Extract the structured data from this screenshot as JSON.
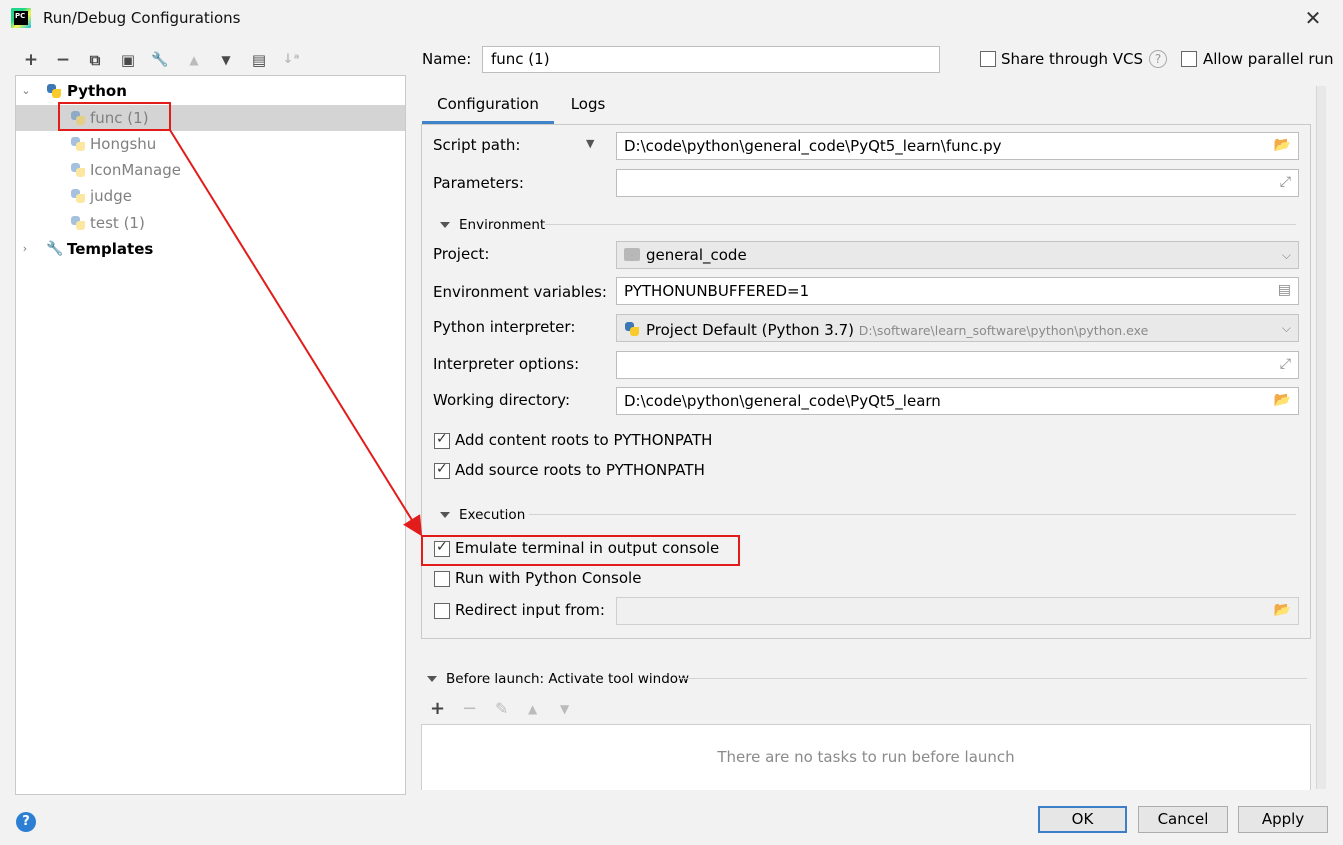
{
  "window": {
    "title": "Run/Debug Configurations",
    "logo_text": "PC",
    "close_glyph": "✕"
  },
  "toolbar": {
    "add": "+",
    "remove": "−",
    "copy": "⧉",
    "save": "▣",
    "edit": "🔧",
    "move_up": "▲",
    "move_down": "▼",
    "folder": "▤",
    "sort": "↓ᵃ"
  },
  "tree": {
    "python_group": "Python",
    "items": [
      {
        "label": "func (1)"
      },
      {
        "label": "Hongshu"
      },
      {
        "label": "IconManage"
      },
      {
        "label": "judge"
      },
      {
        "label": "test (1)"
      }
    ],
    "templates": "Templates"
  },
  "name": {
    "label": "Name:",
    "value": "func (1)"
  },
  "options": {
    "share_vcs": "Share through VCS",
    "share_vcs_checked": false,
    "help_glyph": "?",
    "allow_parallel": "Allow parallel run",
    "allow_parallel_checked": false
  },
  "tabs": [
    "Configuration",
    "Logs"
  ],
  "config": {
    "script_path_label": "Script path:",
    "script_path_value": "D:\\code\\python\\general_code\\PyQt5_learn\\func.py",
    "parameters_label": "Parameters:",
    "parameters_value": "",
    "environment_section": "Environment",
    "project_label": "Project:",
    "project_value": "general_code",
    "env_vars_label": "Environment variables:",
    "env_vars_value": "PYTHONUNBUFFERED=1",
    "interpreter_label": "Python interpreter:",
    "interpreter_value": "Project Default (Python 3.7)",
    "interpreter_path": "D:\\software\\learn_software\\python\\python.exe",
    "interp_options_label": "Interpreter options:",
    "interp_options_value": "",
    "working_dir_label": "Working directory:",
    "working_dir_value": "D:\\code\\python\\general_code\\PyQt5_learn",
    "add_content_roots": "Add content roots to PYTHONPATH",
    "add_content_roots_checked": true,
    "add_source_roots": "Add source roots to PYTHONPATH",
    "add_source_roots_checked": true,
    "execution_section": "Execution",
    "emulate_terminal": "Emulate terminal in output console",
    "emulate_terminal_checked": true,
    "run_with_console": "Run with Python Console",
    "run_with_console_checked": false,
    "redirect_input": "Redirect input from:",
    "redirect_input_checked": false,
    "redirect_input_value": ""
  },
  "before_launch": {
    "title": "Before launch: Activate tool window",
    "add": "+",
    "remove": "−",
    "edit": "✎",
    "up": "▲",
    "down": "▼",
    "empty_text": "There are no tasks to run before launch"
  },
  "buttons": {
    "help": "?",
    "ok": "OK",
    "cancel": "Cancel",
    "apply": "Apply"
  },
  "colors": {
    "annotation_red": "#e21b1b",
    "selection_bg": "#d4d4d4",
    "tab_underline": "#4083c9"
  }
}
